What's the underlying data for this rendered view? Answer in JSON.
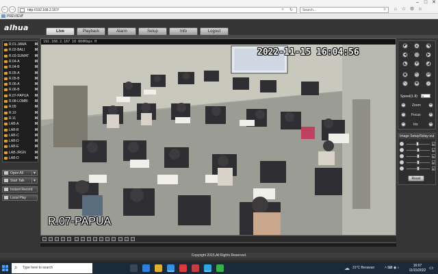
{
  "browser": {
    "url": "http://192.168.2.167/",
    "search_placeholder": "Search...",
    "tab_title": "PREVIEW",
    "back_icon": "arrow-left-icon",
    "forward_icon": "arrow-right-icon"
  },
  "app": {
    "logo": "alhua",
    "nav": [
      "Live",
      "Playback",
      "Alarm",
      "Setup",
      "Info",
      "Logout"
    ],
    "active_nav": "Live",
    "channels": [
      {
        "label": "R.01-JAWA",
        "flag": "M"
      },
      {
        "label": "R.02-BALI",
        "flag": "M"
      },
      {
        "label": "R.03-SUMAT",
        "flag": "M"
      },
      {
        "label": "R.04-A",
        "flag": "M"
      },
      {
        "label": "R.04-B",
        "flag": "M"
      },
      {
        "label": "R.05-A",
        "flag": "M"
      },
      {
        "label": "R.05-B",
        "flag": "M"
      },
      {
        "label": "R.06-A",
        "flag": "M"
      },
      {
        "label": "R.06-B",
        "flag": "M"
      },
      {
        "label": "R.07-PAPUA",
        "flag": "M"
      },
      {
        "label": "R.08-LOMBI",
        "flag": "M"
      },
      {
        "label": "R.09",
        "flag": "M"
      },
      {
        "label": "R.10",
        "flag": "M"
      },
      {
        "label": "R.11",
        "flag": "M"
      },
      {
        "label": "LAB-A",
        "flag": "M"
      },
      {
        "label": "LAB-B",
        "flag": "M"
      },
      {
        "label": "LAB-C",
        "flag": "M"
      },
      {
        "label": "LAB-D",
        "flag": "M"
      },
      {
        "label": "LAB-E",
        "flag": "M"
      },
      {
        "label": "LAB-JRGN",
        "flag": "M"
      },
      {
        "label": "LAB-D",
        "flag": "M"
      }
    ],
    "buttons": {
      "open_all": "Open All",
      "start_talk": "Start Talk",
      "instant_record": "Instant Record",
      "local_play": "Local Play"
    },
    "video": {
      "info": "192.168.2.167 10 860Kbps H",
      "osd_time": "2022-11-15 16:04:56",
      "osd_channel": "R.07-PAPUA"
    },
    "ptz": {
      "speed_label": "Speed(1-8)",
      "speed_value": "5",
      "zoom_label": "Zoom",
      "focus_label": "Focus",
      "iris_label": "Iris"
    },
    "image": {
      "tab_setup": "Image Setup",
      "tab_relay": "Relay-out",
      "levels": [
        0.45,
        0.5,
        0.5,
        0.5,
        0.5
      ],
      "reset": "Reset"
    },
    "copyright": "Copyright 2015,All Rights Reserved."
  },
  "taskbar": {
    "search_placeholder": "Type here to search",
    "weather": "31°C  Berawan",
    "time": "16:07",
    "date": "11/15/2022"
  }
}
